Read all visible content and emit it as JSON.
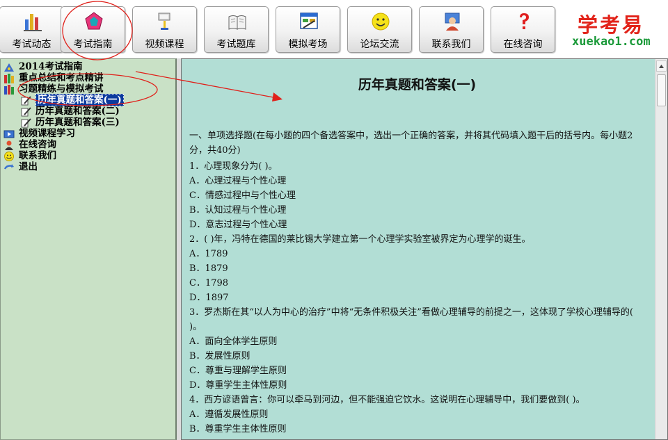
{
  "toolbar": {
    "buttons": [
      {
        "label": "考试动态",
        "icon": "chart-icon"
      },
      {
        "label": "考试指南",
        "icon": "pentagon-icon"
      },
      {
        "label": "视频课程",
        "icon": "projector-icon"
      },
      {
        "label": "考试题库",
        "icon": "book-icon"
      },
      {
        "label": "模拟考场",
        "icon": "exam-window-icon"
      },
      {
        "label": "论坛交流",
        "icon": "smiley-icon"
      },
      {
        "label": "联系我们",
        "icon": "people-icon"
      },
      {
        "label": "在线咨询",
        "icon": "question-icon"
      }
    ],
    "logo": {
      "cn": "学考易",
      "en": "xuekao1.com"
    }
  },
  "tree": {
    "items": [
      {
        "label": "2014考试指南",
        "icon": "guide-icon"
      },
      {
        "label": "重点总结和考点精讲",
        "icon": "books-icon"
      },
      {
        "label": "习题精练与模拟考试",
        "icon": "books-icon"
      },
      {
        "label": "历年真题和答案(一)",
        "icon": "pencil-icon",
        "selected": true
      },
      {
        "label": "历年真题和答案(二)",
        "icon": "pencil-icon"
      },
      {
        "label": "历年真题和答案(三)",
        "icon": "pencil-icon"
      },
      {
        "label": "视频课程学习",
        "icon": "video-icon"
      },
      {
        "label": "在线咨询",
        "icon": "person-icon"
      },
      {
        "label": "联系我们",
        "icon": "smiley-icon"
      },
      {
        "label": "退出",
        "icon": "exit-icon"
      }
    ]
  },
  "content": {
    "title": "历年真题和答案(一)",
    "intro": "一、单项选择题(在每小题的四个备选答案中，选出一个正确的答案，并将其代码填入题干后的括号内。每小题2分，共40分)",
    "q1": "1．心理现象分为( )。",
    "q1a": "A．心理过程与个性心理",
    "q1c": "C．情感过程中与个性心理",
    "q1b": "B．认知过程与个性心理",
    "q1d": "D．意志过程与个性心理",
    "q2": "2．( )年，冯特在德国的莱比锡大学建立第一个心理学实验室被界定为心理学的诞生。",
    "q2a": "A．1789",
    "q2b": "B．1879",
    "q2c": "C．1798",
    "q2d": "D．1897",
    "q3": "3．罗杰斯在其“以人为中心的治疗”中将“无条件积极关注”看做心理辅导的前提之一，这体现了学校心理辅导的( )。",
    "q3a": "A．面向全体学生原则",
    "q3b": "B．发展性原则",
    "q3c": "C．尊重与理解学生原则",
    "q3d": "D．尊重学生主体性原则",
    "q4": "4．西方谚语曾言：你可以牵马到河边，但不能强迫它饮水。这说明在心理辅导中，我们要做到( )。",
    "q4a": "A．遵循发展性原则",
    "q4b": "B．尊重学生主体性原则"
  },
  "colors": {
    "tree_bg": "#c9e1c6",
    "content_bg": "#b2ded5",
    "selection": "#0b3a9e",
    "annotation": "#e0201a"
  }
}
